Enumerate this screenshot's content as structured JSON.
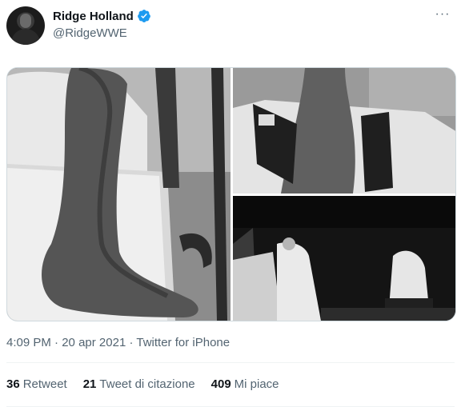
{
  "tweet": {
    "author": {
      "display_name": "Ridge Holland",
      "handle": "@RidgeWWE",
      "verified": true
    },
    "more_icon": "more-horizontal-icon",
    "media": [
      {
        "alt_label": "photo-leg-foot"
      },
      {
        "alt_label": "photo-leg-brace"
      },
      {
        "alt_label": "photo-leg-cast"
      }
    ],
    "time": "4:09 PM",
    "date": "20 apr 2021",
    "source": "Twitter for iPhone",
    "separator": "·"
  },
  "stats": [
    {
      "count": "36",
      "label": "Retweet"
    },
    {
      "count": "21",
      "label": "Tweet di citazione"
    },
    {
      "count": "409",
      "label": "Mi piace"
    }
  ],
  "colors": {
    "text_primary": "#0f1419",
    "text_secondary": "#536471",
    "verified_blue": "#1d9bf0",
    "border": "#cfd9de"
  }
}
